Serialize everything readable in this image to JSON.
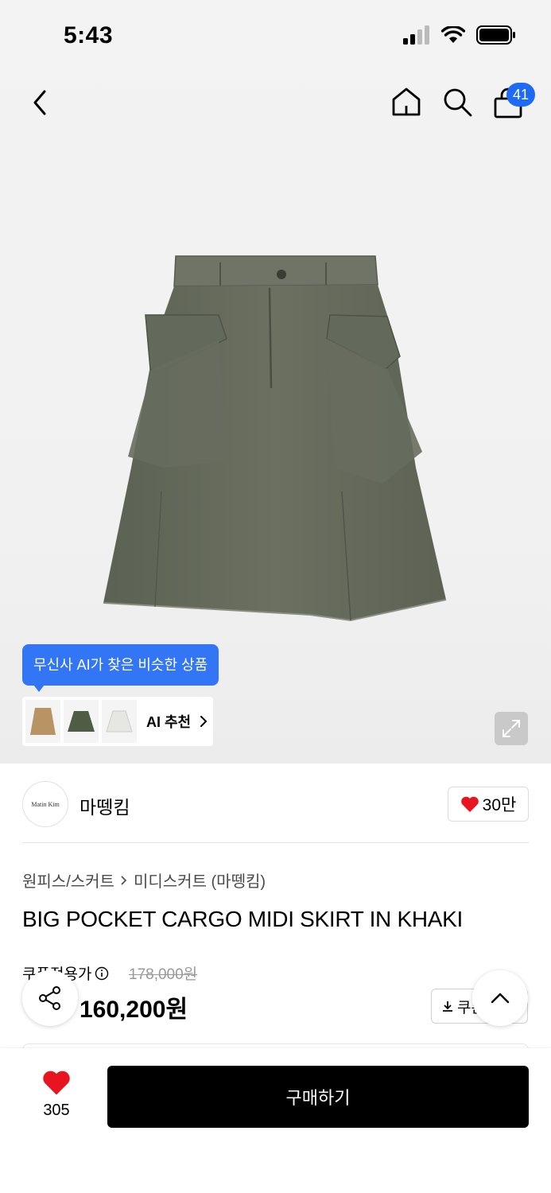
{
  "status_bar": {
    "time": "5:43"
  },
  "header": {
    "cart_count": "41"
  },
  "ai_recommend": {
    "tooltip": "무신사 AI가 찾은 비슷한 상품",
    "label": "AI 추천",
    "thumbnails": [
      "beige-skirt",
      "green-skirt",
      "white-skirt"
    ]
  },
  "brand": {
    "logo_text": "Matin Kim",
    "name": "마뗑킴",
    "likes": "30만"
  },
  "breadcrumb": {
    "category": "원피스/스커트",
    "subcategory": "미디스커트 (마뗑킴)"
  },
  "product": {
    "title": "BIG POCKET CARGO MIDI SKIRT IN KHAKI",
    "coupon_label": "쿠폰적용가",
    "original_price": "178,000원",
    "price": "160,200원",
    "coupon_button": "쿠폰"
  },
  "bottom_bar": {
    "like_count": "305",
    "buy_label": "구매하기"
  },
  "colors": {
    "accent_blue": "#3276f6",
    "heart_red": "#e8141f",
    "buy_black": "#000000"
  }
}
